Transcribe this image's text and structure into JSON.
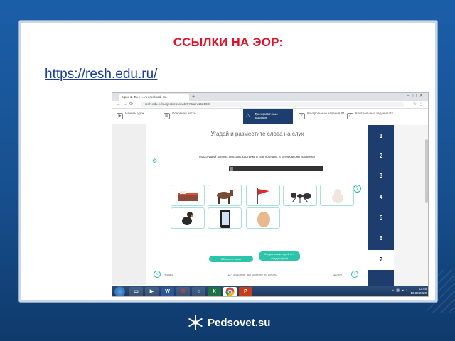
{
  "slide": {
    "title": "ССЫЛКИ НА ЭОР:",
    "link": "https://resh.edu.ru/"
  },
  "browser": {
    "tab_label": "Урок 1. Ты у ... Английский яз...",
    "url": "resh.edu.ru/subject/lesson/4297/train/152188/",
    "lesson_nav": [
      {
        "icon": "play-icon",
        "label": "Начнем урок"
      },
      {
        "icon": "book-icon",
        "label": "Основная часть"
      },
      {
        "icon": "triangle-icon",
        "label": "Тренировочные задания"
      },
      {
        "icon": "check-icon",
        "label": "Контрольные задания В1"
      },
      {
        "icon": "check-icon",
        "label": "Контрольные задания В2"
      }
    ],
    "task": {
      "title": "Угадай и разместите слова на слух",
      "description": "Прослушай запись. Поставь картинки в том порядке, в котором они прозвучат",
      "tiles": [
        "bed",
        "horse",
        "flag",
        "ant",
        "cat",
        "dog",
        "phone",
        "egg"
      ],
      "check_button": "Сохранить и перейти к следующему",
      "reset_button": "Сбросить ответ",
      "prev_label": "Назад",
      "next_label": "Далее",
      "footer_note": "1/7 Задание выполнено не верно"
    },
    "numbers": [
      "1",
      "2",
      "3",
      "4",
      "5",
      "6",
      "7"
    ],
    "active_number": "7",
    "taskbar": {
      "icons": [
        "folder",
        "media",
        "W",
        "yandex",
        "ie",
        "excel",
        "chrome",
        "P"
      ],
      "clock_time": "13:46",
      "clock_date": "16.09.2020"
    }
  },
  "footer": {
    "brand": "Pedsovet.su"
  },
  "colors": {
    "title_red": "#e0132b",
    "link_blue": "#1a3e9a",
    "background_blue": "#1b5ea8",
    "nav_dark": "#1d3d6e",
    "accent_teal": "#2cc5aa"
  }
}
